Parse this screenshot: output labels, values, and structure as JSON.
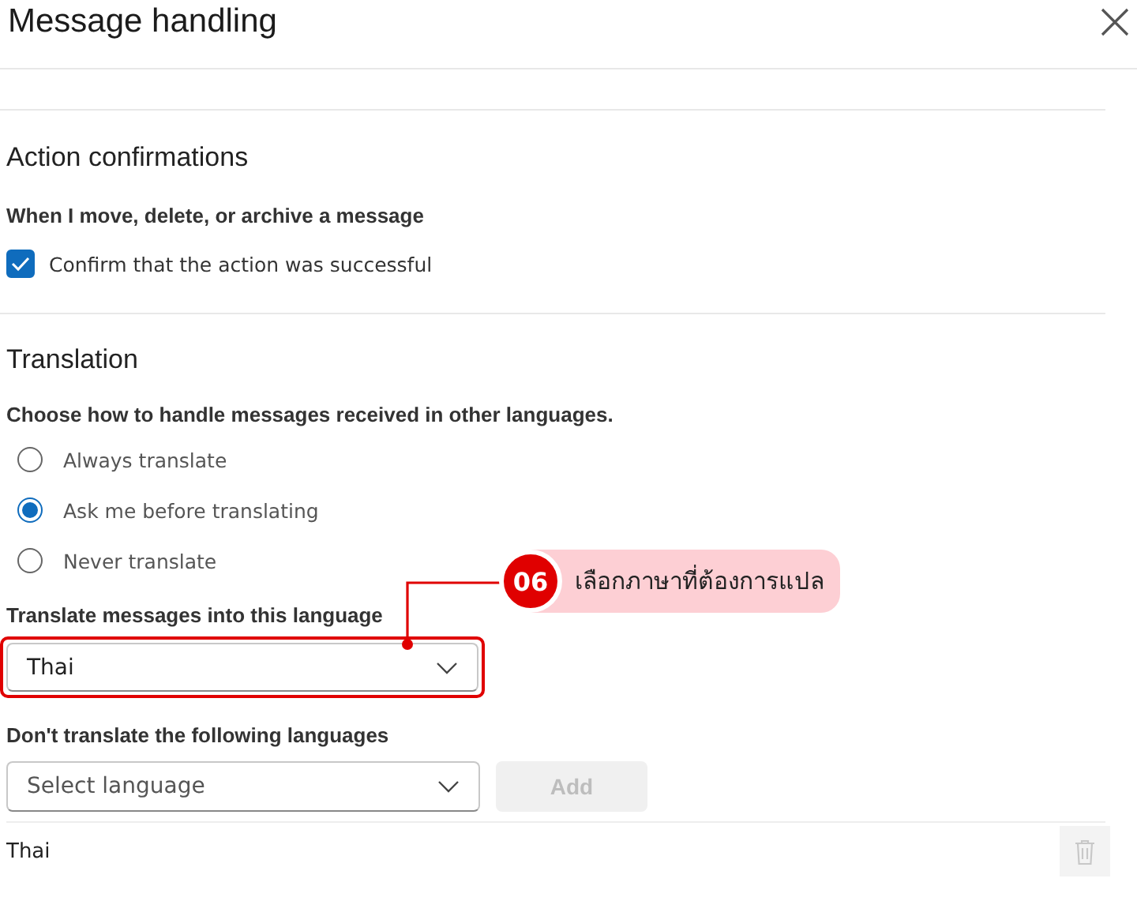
{
  "title": "Message handling",
  "action_confirmations": {
    "heading": "Action confirmations",
    "subheading": "When I move, delete, or archive a message",
    "checkbox": {
      "label": "Confirm that the action was successful",
      "checked": true
    }
  },
  "translation": {
    "heading": "Translation",
    "subheading": "Choose how to handle messages received in other languages.",
    "options": [
      {
        "label": "Always translate",
        "selected": false
      },
      {
        "label": "Ask me before translating",
        "selected": true
      },
      {
        "label": "Never translate",
        "selected": false
      }
    ],
    "target_language": {
      "label": "Translate messages into this language",
      "value": "Thai"
    },
    "exclusions": {
      "label": "Don't translate the following languages",
      "placeholder": "Select language",
      "add_button": {
        "label": "Add",
        "disabled": true
      },
      "languages": [
        "Thai"
      ]
    }
  },
  "callout": {
    "number": "06",
    "text": "เลือกภาษาที่ต้องการแปล"
  }
}
